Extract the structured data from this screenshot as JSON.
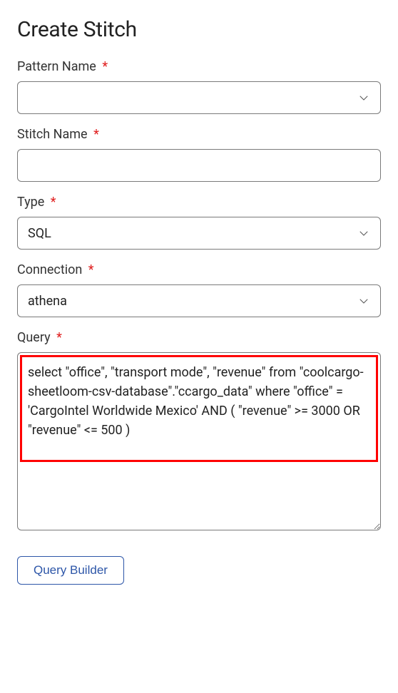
{
  "title": "Create Stitch",
  "fields": {
    "pattern_name": {
      "label": "Pattern Name",
      "required_mark": "*",
      "value": ""
    },
    "stitch_name": {
      "label": "Stitch Name",
      "required_mark": "*",
      "value": ""
    },
    "type": {
      "label": "Type",
      "required_mark": "*",
      "value": "SQL"
    },
    "connection": {
      "label": "Connection",
      "required_mark": "*",
      "value": "athena"
    },
    "query": {
      "label": "Query",
      "required_mark": "*",
      "value": "select \"office\", \"transport mode\", \"revenue\" from \"coolcargo-sheetloom-csv-database\".\"ccargo_data\" where \"office\" = 'CargoIntel Worldwide Mexico' AND ( \"revenue\" >= 3000 OR \"revenue\" <= 500 )"
    }
  },
  "buttons": {
    "query_builder": "Query Builder"
  }
}
